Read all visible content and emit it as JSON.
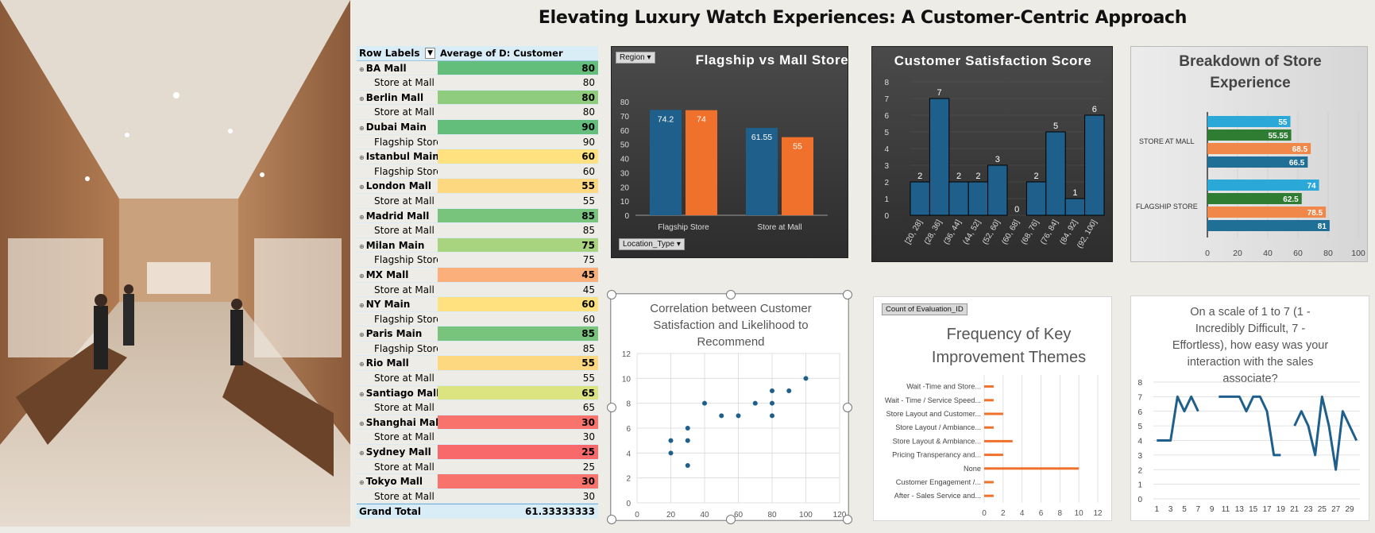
{
  "dashboard": {
    "title": "Elevating Luxury Watch Experiences: A Customer-Centric Approach"
  },
  "pivot": {
    "header_labels": "Row Labels",
    "header_values": "Average of D: Customer Satisfaction",
    "rows": [
      {
        "label": "BA Mall",
        "value": "80",
        "sub": "Store at Mall",
        "sub_value": "80",
        "color": "#63be7b"
      },
      {
        "label": "Berlin Mall",
        "value": "80",
        "sub": "Store at Mall",
        "sub_value": "80",
        "color": "#8fcc7e"
      },
      {
        "label": "Dubai Main",
        "value": "90",
        "sub": "Flagship Store",
        "sub_value": "90",
        "color": "#63be7b"
      },
      {
        "label": "Istanbul Main",
        "value": "60",
        "sub": "Flagship Store",
        "sub_value": "60",
        "color": "#ffe17f"
      },
      {
        "label": "London Mall",
        "value": "55",
        "sub": "Store at Mall",
        "sub_value": "55",
        "color": "#fed880"
      },
      {
        "label": "Madrid Mall",
        "value": "85",
        "sub": "Store at Mall",
        "sub_value": "85",
        "color": "#78c47d"
      },
      {
        "label": "Milan Main",
        "value": "75",
        "sub": "Flagship Store",
        "sub_value": "75",
        "color": "#a9d47f"
      },
      {
        "label": "MX Mall",
        "value": "45",
        "sub": "Store at Mall",
        "sub_value": "45",
        "color": "#fbb07b"
      },
      {
        "label": "NY Main",
        "value": "60",
        "sub": "Flagship Store",
        "sub_value": "60",
        "color": "#ffe17f"
      },
      {
        "label": "Paris Main",
        "value": "85",
        "sub": "Flagship Store",
        "sub_value": "85",
        "color": "#78c47d"
      },
      {
        "label": "Rio Mall",
        "value": "55",
        "sub": "Store at Mall",
        "sub_value": "55",
        "color": "#fed880"
      },
      {
        "label": "Santiago Mall",
        "value": "65",
        "sub": "Store at Mall",
        "sub_value": "65",
        "color": "#dce381"
      },
      {
        "label": "Shanghai Mall",
        "value": "30",
        "sub": "Store at Mall",
        "sub_value": "30",
        "color": "#f8736c"
      },
      {
        "label": "Sydney Mall",
        "value": "25",
        "sub": "Store at Mall",
        "sub_value": "25",
        "color": "#f8696b"
      },
      {
        "label": "Tokyo Mall",
        "value": "30",
        "sub": "Store at Mall",
        "sub_value": "30",
        "color": "#f8736c"
      }
    ],
    "grand_total_label": "Grand Total",
    "grand_total_value": "61.33333333"
  },
  "filters": {
    "region": "Region",
    "location_type": "Location_Type",
    "count_field": "Count of Evaluation_ID"
  },
  "chart_data": [
    {
      "type": "bar",
      "title": "Flagship vs Mall Stores",
      "categories": [
        "Flagship Store",
        "Store at Mall"
      ],
      "series": [
        {
          "values": [
            74.2,
            61.55
          ],
          "color": "#1f5f8b"
        },
        {
          "values": [
            74,
            55
          ],
          "color": "#f0712b"
        }
      ],
      "ylim": [
        0,
        80
      ],
      "yticks": [
        "0",
        "10",
        "20",
        "30",
        "40",
        "50",
        "60",
        "70",
        "80"
      ],
      "data_labels": [
        [
          "74.2",
          "61.55"
        ],
        [
          "74",
          "55"
        ]
      ]
    },
    {
      "type": "bar",
      "title": "Customer Satisfaction Score",
      "categories": [
        "[20, 28]",
        "(28, 36]",
        "(36, 44]",
        "(44, 52]",
        "(52, 60]",
        "(60, 68]",
        "(68, 76]",
        "(76, 84]",
        "(84, 92]",
        "(92, 100]"
      ],
      "values": [
        2,
        7,
        2,
        2,
        3,
        0,
        2,
        5,
        1,
        6
      ],
      "data_labels": [
        "2",
        "7",
        "2",
        "2",
        "3",
        "0",
        "2",
        "5",
        "1",
        "6"
      ],
      "ylim": [
        0,
        8
      ],
      "yticks": [
        "0",
        "1",
        "2",
        "3",
        "4",
        "5",
        "6",
        "7",
        "8"
      ]
    },
    {
      "type": "bar",
      "title": "Breakdown of Store Experience",
      "categories": [
        "STORE AT MALL",
        "FLAGSHIP STORE"
      ],
      "bars": [
        {
          "group": "STORE AT MALL",
          "value": 55,
          "label": "55",
          "color": "#2aa8d8"
        },
        {
          "group": "STORE AT MALL",
          "value": 55.55,
          "label": "55.55",
          "color": "#2e7d32"
        },
        {
          "group": "STORE AT MALL",
          "value": 68.5,
          "label": "68.5",
          "color": "#f0884a"
        },
        {
          "group": "STORE AT MALL",
          "value": 66.5,
          "label": "66.5",
          "color": "#1f6f96"
        },
        {
          "group": "FLAGSHIP STORE",
          "value": 74,
          "label": "74",
          "color": "#2aa8d8"
        },
        {
          "group": "FLAGSHIP STORE",
          "value": 62.5,
          "label": "62.5",
          "color": "#2e7d32"
        },
        {
          "group": "FLAGSHIP STORE",
          "value": 78.5,
          "label": "78.5",
          "color": "#f0884a"
        },
        {
          "group": "FLAGSHIP STORE",
          "value": 81,
          "label": "81",
          "color": "#1f6f96"
        }
      ],
      "xlim": [
        0,
        100
      ],
      "xticks": [
        "0",
        "20",
        "40",
        "60",
        "80",
        "100"
      ]
    },
    {
      "type": "scatter",
      "title": "Correlation between Customer Satisfaction and Likelihood to Recommend",
      "points": [
        [
          20,
          5
        ],
        [
          20,
          4
        ],
        [
          30,
          6
        ],
        [
          30,
          5
        ],
        [
          30,
          3
        ],
        [
          40,
          8
        ],
        [
          50,
          7
        ],
        [
          60,
          7
        ],
        [
          70,
          8
        ],
        [
          80,
          9
        ],
        [
          80,
          8
        ],
        [
          80,
          7
        ],
        [
          90,
          9
        ],
        [
          100,
          10
        ]
      ],
      "xlim": [
        0,
        120
      ],
      "ylim": [
        0,
        12
      ],
      "xticks": [
        "0",
        "20",
        "40",
        "60",
        "80",
        "100",
        "120"
      ],
      "yticks": [
        "0",
        "2",
        "4",
        "6",
        "8",
        "10",
        "12"
      ]
    },
    {
      "type": "bar",
      "title": "Frequency of Key Improvement Themes",
      "categories": [
        "Wait -Time and Store...",
        "Wait - Time / Service Speed...",
        "Store Layout and Customer...",
        "Store Layout / Ambiance...",
        "Store Layout & Ambiance...",
        "Pricing Transperancy and...",
        "None",
        "Customer Engagement /...",
        "After - Sales Service and..."
      ],
      "values": [
        1,
        1,
        2,
        1,
        3,
        2,
        10,
        1,
        1
      ],
      "xlim": [
        0,
        12
      ],
      "xticks": [
        "0",
        "2",
        "4",
        "6",
        "8",
        "10",
        "12"
      ]
    },
    {
      "type": "line",
      "title": "On a scale of 1 to 7 (1 - Incredibly Difficult, 7 - Effortless), how easy was your interaction with the sales associate?",
      "x": [
        1,
        2,
        3,
        4,
        5,
        6,
        7,
        8,
        9,
        10,
        11,
        12,
        13,
        14,
        15,
        16,
        17,
        18,
        19,
        20,
        21,
        22,
        23,
        24,
        25,
        26,
        27,
        28,
        29,
        30
      ],
      "segments": [
        {
          "x": [
            1,
            2,
            3,
            4,
            5,
            6,
            7
          ],
          "y": [
            4,
            4,
            4,
            7,
            6,
            7,
            6
          ]
        },
        {
          "x": [
            10,
            11,
            12,
            13,
            14,
            15,
            16,
            17,
            18,
            19
          ],
          "y": [
            7,
            7,
            7,
            7,
            6,
            7,
            7,
            6,
            3,
            3
          ]
        },
        {
          "x": [
            21,
            22,
            23,
            24,
            25,
            26,
            27,
            28,
            29,
            30
          ],
          "y": [
            5,
            6,
            5,
            3,
            7,
            5,
            2,
            6,
            5,
            4
          ]
        }
      ],
      "ylim": [
        0,
        8
      ],
      "yticks": [
        "0",
        "1",
        "2",
        "3",
        "4",
        "5",
        "6",
        "7",
        "8"
      ],
      "xticks": [
        "1",
        "3",
        "5",
        "7",
        "9",
        "11",
        "13",
        "15",
        "17",
        "19",
        "21",
        "23",
        "25",
        "27",
        "29"
      ]
    }
  ]
}
